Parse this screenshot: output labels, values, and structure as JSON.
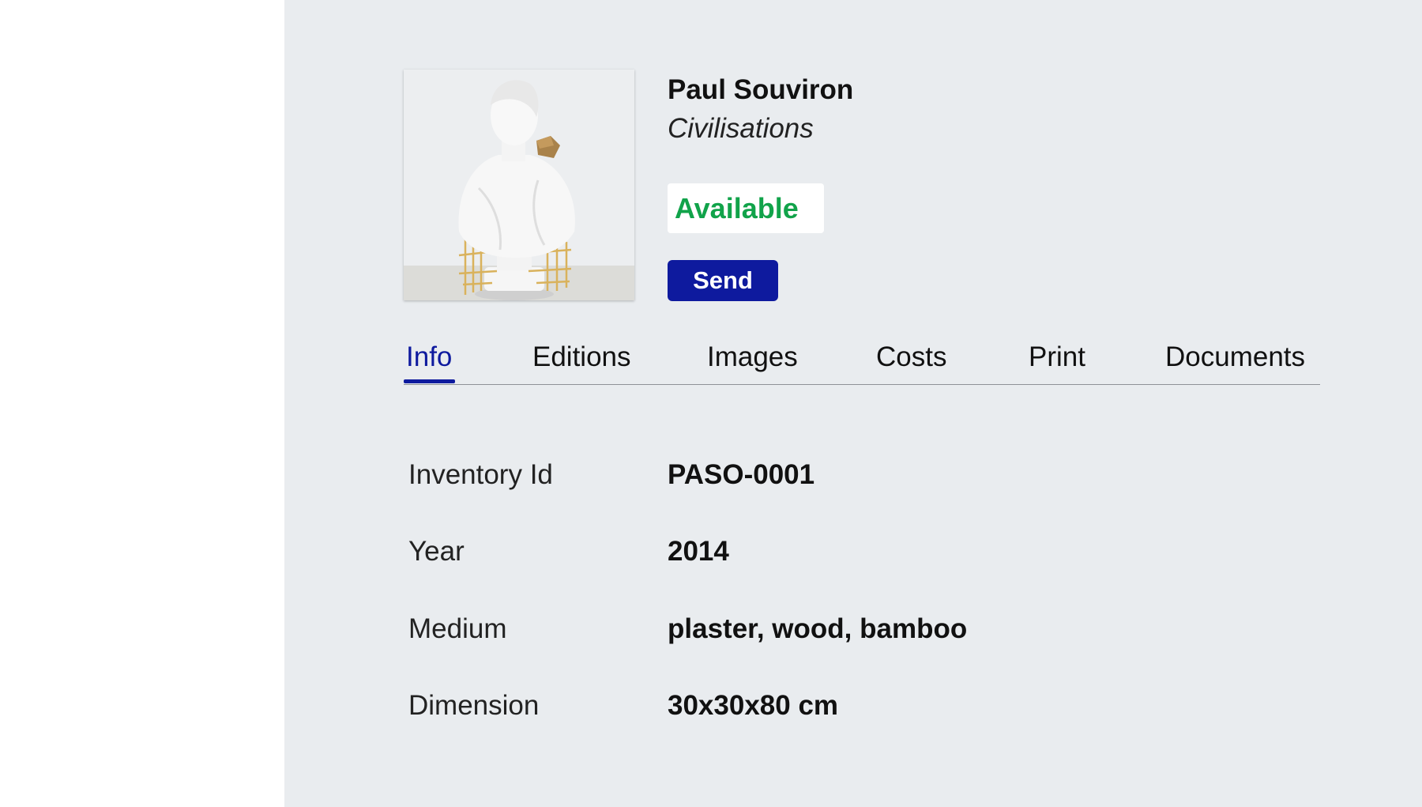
{
  "artwork": {
    "artist": "Paul Souviron",
    "title": "Civilisations",
    "status": "Available",
    "status_color": "#11a34a",
    "image_icon": "sculpture-image"
  },
  "actions": {
    "send_label": "Send",
    "accent_color": "#0e1a9e"
  },
  "tabs": [
    {
      "label": "Info",
      "active": true
    },
    {
      "label": "Editions",
      "active": false
    },
    {
      "label": "Images",
      "active": false
    },
    {
      "label": "Costs",
      "active": false
    },
    {
      "label": "Print",
      "active": false
    },
    {
      "label": "Documents",
      "active": false
    }
  ],
  "info": [
    {
      "label": "Inventory Id",
      "value": "PASO-0001"
    },
    {
      "label": "Year",
      "value": "2014"
    },
    {
      "label": "Medium",
      "value": "plaster, wood, bamboo"
    },
    {
      "label": "Dimension",
      "value": "30x30x80 cm"
    }
  ]
}
